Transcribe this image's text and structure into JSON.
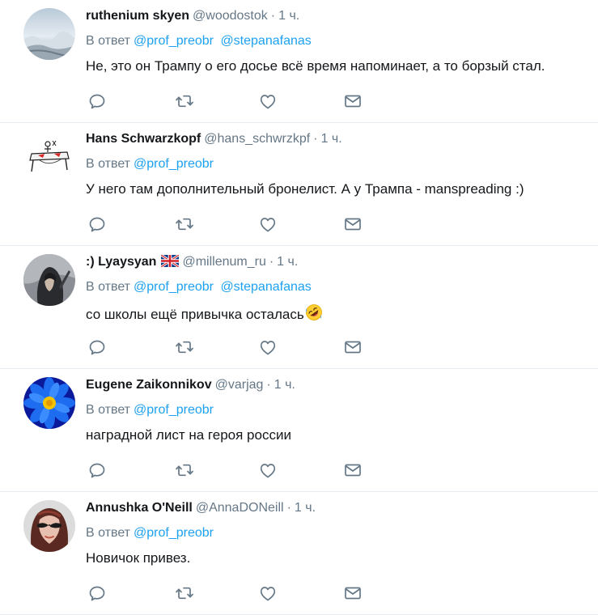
{
  "reply_prefix": "В ответ",
  "tweets": [
    {
      "fullname": "ruthenium skyen",
      "username": "@woodostok",
      "time": "1 ч.",
      "mentions": [
        "@prof_preobr",
        "@stepanafanas"
      ],
      "text": "Не, это он Трампу о его досье всё время напоминает, а то борзый стал."
    },
    {
      "fullname": "Hans Schwarzkopf",
      "username": "@hans_schwrzkpf",
      "time": "1 ч.",
      "mentions": [
        "@prof_preobr"
      ],
      "text": "У него там дополнительный бронелист. А у Трампа - manspreading :)"
    },
    {
      "fullname": ":) Lyaysyan",
      "username": "@millenum_ru",
      "time": "1 ч.",
      "mentions": [
        "@prof_preobr",
        "@stepanafanas"
      ],
      "text": "со школы ещё привычка осталась",
      "emoji": "rolling-on-floor-laughing"
    },
    {
      "fullname": "Eugene Zaikonnikov",
      "username": "@varjag",
      "time": "1 ч.",
      "mentions": [
        "@prof_preobr"
      ],
      "text": "наградной лист на героя россии"
    },
    {
      "fullname": "Annushka O'Neill",
      "username": "@AnnaDONeill",
      "time": "1 ч.",
      "mentions": [
        "@prof_preobr"
      ],
      "text": "Новичок привез."
    }
  ],
  "icons": [
    "reply-icon",
    "retweet-icon",
    "like-icon",
    "direct-message-icon"
  ],
  "colors": {
    "link": "#1da1f2",
    "meta": "#657786",
    "text": "#14171a",
    "icon": "#657786",
    "divider": "#e6ecf0"
  }
}
